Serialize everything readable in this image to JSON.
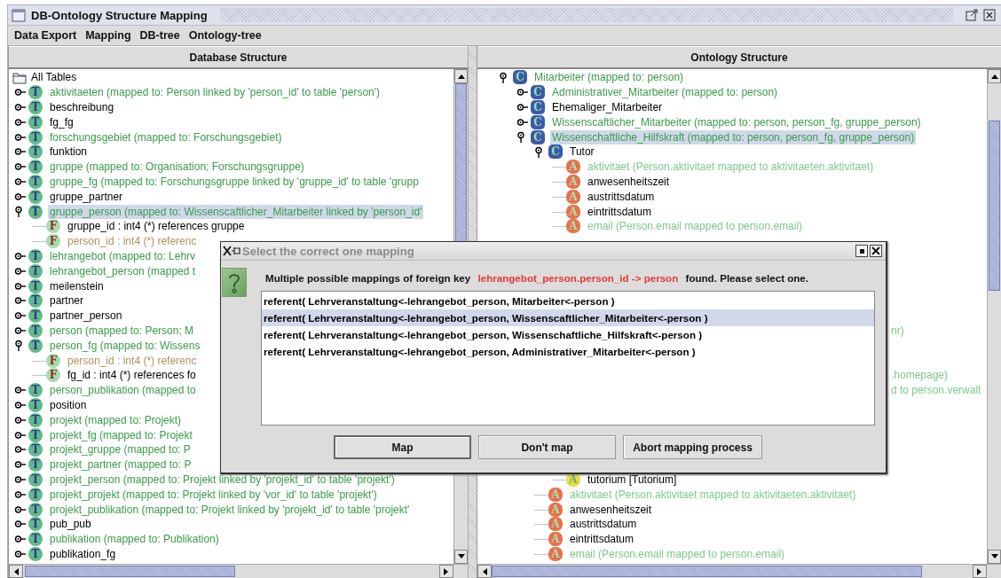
{
  "window": {
    "title": "DB-Ontology Structure Mapping"
  },
  "menu": [
    "Data Export",
    "Mapping",
    "DB-tree",
    "Ontology-tree"
  ],
  "db_panel": {
    "header": "Database Structure",
    "tree": {
      "kind": "root",
      "label": "All Tables",
      "selected": false,
      "children": [
        {
          "kind": "table",
          "icon": "T",
          "label": "aktivitaeten  (mapped to: Person linked by 'person_id' to table 'person')",
          "mapped": true,
          "expanded": false,
          "selected": false
        },
        {
          "kind": "table",
          "icon": "T",
          "label": "beschreibung",
          "mapped": false,
          "expanded": false,
          "selected": false
        },
        {
          "kind": "table",
          "icon": "T",
          "label": "fg_fg",
          "mapped": false,
          "expanded": false,
          "selected": false
        },
        {
          "kind": "table",
          "icon": "T",
          "label": "forschungsgebiet  (mapped to: Forschungsgebiet)",
          "mapped": true,
          "expanded": false,
          "selected": false
        },
        {
          "kind": "table",
          "icon": "T",
          "label": "funktion",
          "mapped": false,
          "expanded": false,
          "selected": false
        },
        {
          "kind": "table",
          "icon": "T",
          "label": "gruppe  (mapped to: Organisation;  Forschungsgruppe)",
          "mapped": true,
          "expanded": false,
          "selected": false
        },
        {
          "kind": "table",
          "icon": "T",
          "label": "gruppe_fg  (mapped to: Forschungsgruppe linked by 'gruppe_id' to table 'grupp",
          "mapped": true,
          "expanded": false,
          "selected": false
        },
        {
          "kind": "table",
          "icon": "T",
          "label": "gruppe_partner",
          "mapped": false,
          "expanded": false,
          "selected": false
        },
        {
          "kind": "table",
          "icon": "T",
          "label": "gruppe_person  (mapped to: Wissenscaftlicher_Mitarbeiter linked by 'person_id'",
          "mapped": true,
          "expanded": true,
          "selected": true,
          "children": [
            {
              "kind": "field",
              "icon": "F",
              "label": "gruppe_id : int4 (*) references gruppe",
              "mapped": false,
              "selected": false
            },
            {
              "kind": "field",
              "icon": "F",
              "label": "person_id : int4 (*) referenc",
              "mapped": true,
              "selected": false
            }
          ]
        },
        {
          "kind": "table",
          "icon": "T",
          "label": "lehrangebot  (mapped to: Lehrv",
          "mapped": true,
          "expanded": false,
          "selected": false
        },
        {
          "kind": "table",
          "icon": "T",
          "label": "lehrangebot_person  (mapped t",
          "mapped": true,
          "expanded": false,
          "selected": false
        },
        {
          "kind": "table",
          "icon": "T",
          "label": "meilenstein",
          "mapped": false,
          "expanded": false,
          "selected": false
        },
        {
          "kind": "table",
          "icon": "T",
          "label": "partner",
          "mapped": false,
          "expanded": false,
          "selected": false
        },
        {
          "kind": "table",
          "icon": "T",
          "label": "partner_person",
          "mapped": false,
          "expanded": false,
          "selected": false
        },
        {
          "kind": "table",
          "icon": "T",
          "label": "person  (mapped to: Person;  M",
          "mapped": true,
          "expanded": false,
          "selected": false
        },
        {
          "kind": "table",
          "icon": "T",
          "label": "person_fg  (mapped to: Wissens",
          "mapped": true,
          "expanded": true,
          "selected": false,
          "children": [
            {
              "kind": "field",
              "icon": "F",
              "label": "person_id : int4 (*) referenc",
              "mapped": true,
              "selected": false
            },
            {
              "kind": "field",
              "icon": "F",
              "label": "fg_id : int4 (*) references fo",
              "mapped": false,
              "selected": false
            }
          ]
        },
        {
          "kind": "table",
          "icon": "T",
          "label": "person_publikation  (mapped to",
          "mapped": true,
          "expanded": false,
          "selected": false
        },
        {
          "kind": "table",
          "icon": "T",
          "label": "position",
          "mapped": false,
          "expanded": false,
          "selected": false
        },
        {
          "kind": "table",
          "icon": "T",
          "label": "projekt  (mapped to: Projekt)",
          "mapped": true,
          "expanded": false,
          "selected": false
        },
        {
          "kind": "table",
          "icon": "T",
          "label": "projekt_fg  (mapped to: Projekt",
          "mapped": true,
          "expanded": false,
          "selected": false
        },
        {
          "kind": "table",
          "icon": "T",
          "label": "projekt_gruppe  (mapped to: P",
          "mapped": true,
          "expanded": false,
          "selected": false
        },
        {
          "kind": "table",
          "icon": "T",
          "label": "projekt_partner  (mapped to: P",
          "mapped": true,
          "expanded": false,
          "selected": false
        },
        {
          "kind": "table",
          "icon": "T",
          "label": "projekt_person  (mapped to: Projekt linked by 'projekt_id' to table 'projekt')",
          "mapped": true,
          "expanded": false,
          "selected": false
        },
        {
          "kind": "table",
          "icon": "T",
          "label": "projekt_projekt  (mapped to: Projekt linked by 'vor_id' to table 'projekt')",
          "mapped": true,
          "expanded": false,
          "selected": false
        },
        {
          "kind": "table",
          "icon": "T",
          "label": "projekt_publikation  (mapped to: Projekt linked by 'projekt_id' to table 'projekt'",
          "mapped": true,
          "expanded": false,
          "selected": false
        },
        {
          "kind": "table",
          "icon": "T",
          "label": "pub_pub",
          "mapped": false,
          "expanded": false,
          "selected": false
        },
        {
          "kind": "table",
          "icon": "T",
          "label": "publikation  (mapped to: Publikation)",
          "mapped": true,
          "expanded": false,
          "selected": false
        },
        {
          "kind": "table",
          "icon": "T",
          "label": "publikation_fg",
          "mapped": false,
          "expanded": false,
          "selected": false
        }
      ]
    }
  },
  "onto_panel": {
    "header": "Ontology Structure",
    "tree": {
      "kind": "class",
      "icon": "C",
      "label": "Mitarbeiter (mapped to: person)",
      "mapped": true,
      "expanded": true,
      "selected": false,
      "children": [
        {
          "kind": "class",
          "icon": "C",
          "label": "Administrativer_Mitarbeiter (mapped to: person)",
          "mapped": true,
          "expanded": false,
          "selected": false
        },
        {
          "kind": "class",
          "icon": "C",
          "label": "Ehemaliger_Mitarbeiter",
          "mapped": false,
          "expanded": false,
          "selected": false
        },
        {
          "kind": "class",
          "icon": "C",
          "label": "Wissenscaftlicher_Mitarbeiter (mapped to: person, person_fg, gruppe_person)",
          "mapped": true,
          "expanded": false,
          "selected": false
        },
        {
          "kind": "class",
          "icon": "C",
          "label": "Wissenschaftliche_Hilfskraft (mapped to: person, person_fg, gruppe_person)",
          "mapped": true,
          "expanded": true,
          "selected": true,
          "children": [
            {
              "kind": "class",
              "icon": "C",
              "label": "Tutor",
              "mapped": false,
              "expanded": true,
              "selected": false,
              "children": [
                {
                  "kind": "attribute",
                  "icon": "A",
                  "label": "aktivitaet (Person.aktivitaet mapped to aktivitaeten.aktivitaet)",
                  "mapped": true,
                  "selected": false
                },
                {
                  "kind": "attribute",
                  "icon": "A",
                  "label": "anwesenheitszeit",
                  "mapped": false,
                  "selected": false
                },
                {
                  "kind": "attribute",
                  "icon": "A",
                  "label": "austrittsdatum",
                  "mapped": false,
                  "selected": false
                },
                {
                  "kind": "attribute",
                  "icon": "A",
                  "label": "eintrittsdatum",
                  "mapped": false,
                  "selected": false
                },
                {
                  "kind": "attribute",
                  "icon": "A",
                  "label": "email (Person.email mapped to person.email)",
                  "mapped": true,
                  "selected": false
                },
                {
                  "kind": "fragment",
                  "label": "nr)",
                  "mapped": true,
                  "selected": false
                },
                {
                  "kind": "fragment",
                  "label": ".homepage)",
                  "mapped": true,
                  "selected": false
                },
                {
                  "kind": "fragment",
                  "label": "d to person.verwalt",
                  "mapped": true,
                  "selected": false
                },
                {
                  "kind": "relation",
                  "icon": "A",
                  "label": "tutorium [Tutorium]",
                  "mapped": false,
                  "selected": false
                }
              ]
            },
            {
              "kind": "attribute",
              "icon": "A",
              "label": "aktivitaet (Person.aktivitaet mapped to aktivitaeten.aktivitaet)",
              "mapped": true,
              "selected": false
            },
            {
              "kind": "attribute",
              "icon": "A",
              "label": "anwesenheitszeit",
              "mapped": false,
              "selected": false
            },
            {
              "kind": "attribute",
              "icon": "A",
              "label": "austrittsdatum",
              "mapped": false,
              "selected": false
            },
            {
              "kind": "attribute",
              "icon": "A",
              "label": "eintrittsdatum",
              "mapped": false,
              "selected": false
            },
            {
              "kind": "attribute",
              "icon": "A",
              "label": "email (Person.email mapped to person.email)",
              "mapped": true,
              "selected": false
            }
          ]
        }
      ]
    }
  },
  "dialog": {
    "title": "Select the correct one mapping",
    "message": {
      "before": "Multiple possible mappings of foreign key",
      "key": "lehrangebot_person.person_id -> person",
      "after": "found. Please select one."
    },
    "options": [
      {
        "label": "referent( Lehrveranstaltung<-lehrangebot_person, Mitarbeiter<-person )",
        "selected": false
      },
      {
        "label": "referent( Lehrveranstaltung<-lehrangebot_person, Wissenscaftlicher_Mitarbeiter<-person )",
        "selected": true
      },
      {
        "label": "referent( Lehrveranstaltung<-lehrangebot_person, Wissenschaftliche_Hilfskraft<-person )",
        "selected": false
      },
      {
        "label": "referent( Lehrveranstaltung<-lehrangebot_person, Administrativer_Mitarbeiter<-person )",
        "selected": false
      }
    ],
    "buttons": [
      {
        "label": "Map",
        "default": true
      },
      {
        "label": "Don't map",
        "default": false
      },
      {
        "label": "Abort mapping process",
        "default": false
      }
    ]
  }
}
